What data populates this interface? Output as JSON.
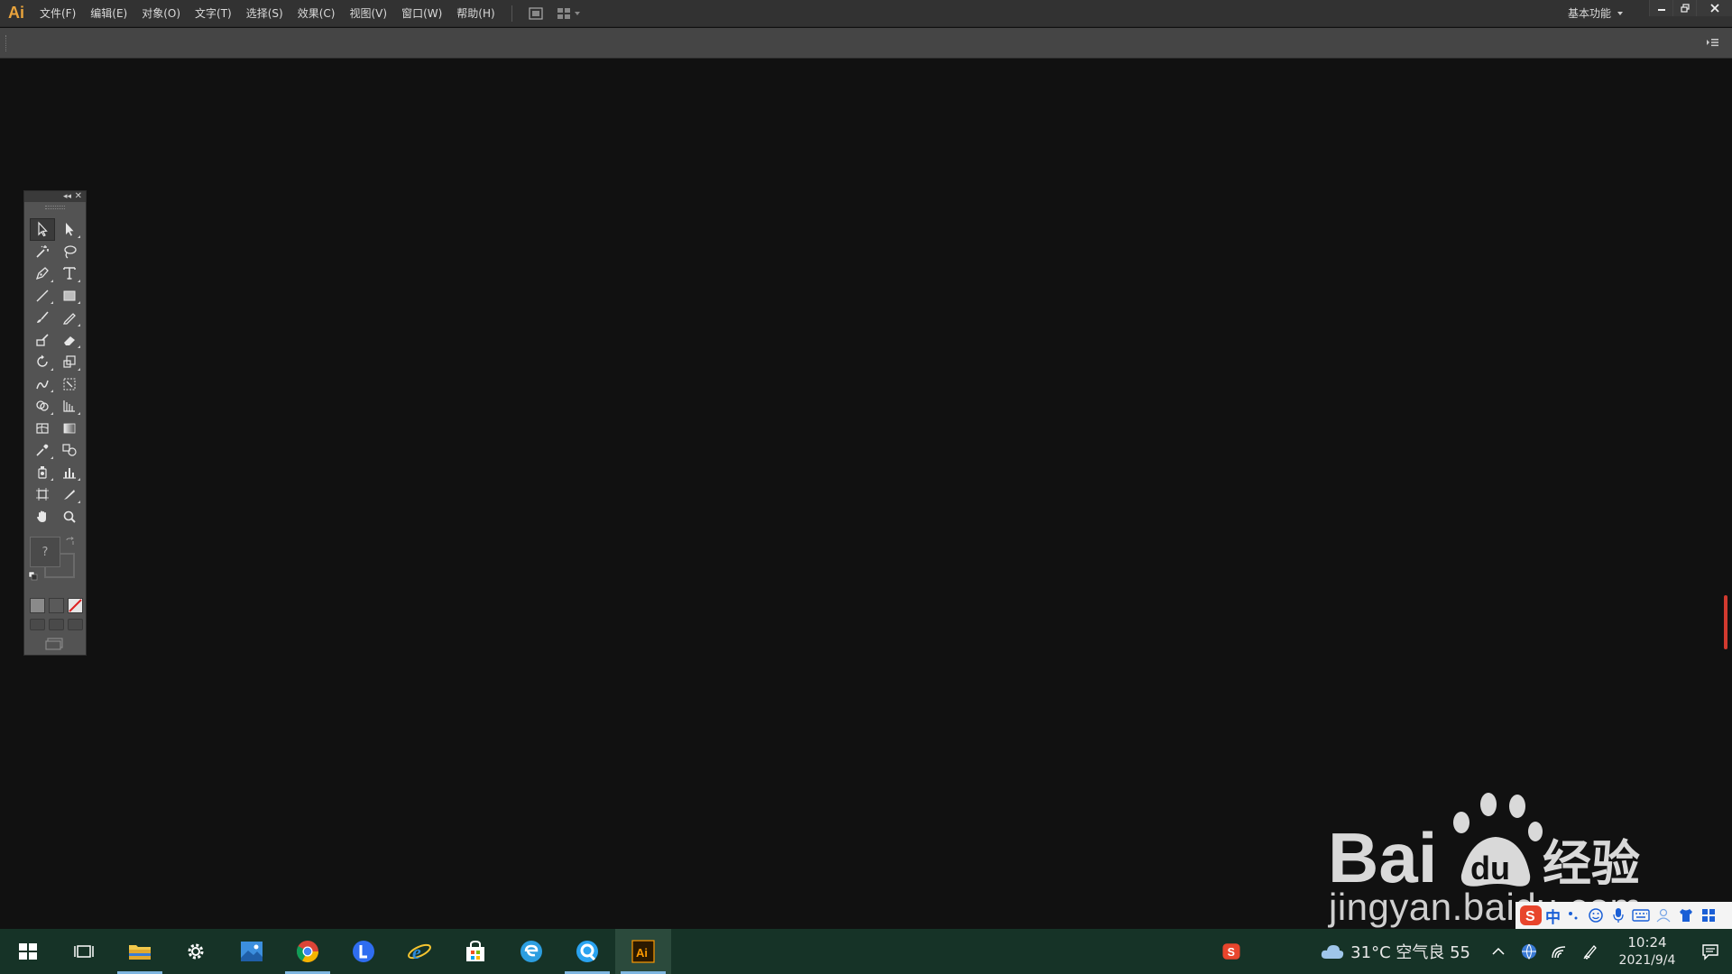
{
  "app": {
    "logo": "Ai"
  },
  "menu": {
    "items": [
      "文件(F)",
      "编辑(E)",
      "对象(O)",
      "文字(T)",
      "选择(S)",
      "效果(C)",
      "视图(V)",
      "窗口(W)",
      "帮助(H)"
    ]
  },
  "workspace": {
    "label": "基本功能"
  },
  "fillstroke": {
    "fill_glyph": "?"
  },
  "watermark": {
    "brand": "Baidu经验",
    "url": "jingyan.baidu.com"
  },
  "ime": {
    "lang": "中"
  },
  "taskbar": {
    "weather_text": "31°C 空气良 55",
    "time": "10:24",
    "date": "2021/9/4"
  },
  "colors": {
    "canvas": "#111111",
    "menubar": "#323232",
    "controlbar": "#454545",
    "toolpanel": "#535353",
    "taskbar": "#163327",
    "accent_ai": "#e8a33c"
  }
}
